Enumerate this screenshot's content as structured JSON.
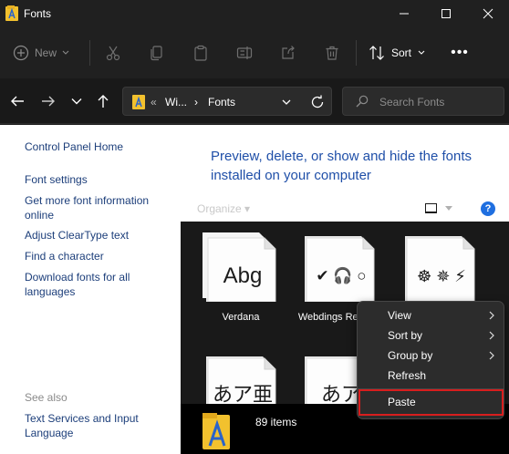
{
  "window": {
    "title": "Fonts"
  },
  "command_bar": {
    "new_label": "New",
    "sort_label": "Sort",
    "more_label": "•••",
    "icons": [
      "cut-icon",
      "copy-icon",
      "paste-icon",
      "rename-icon",
      "share-icon",
      "delete-icon"
    ]
  },
  "address": {
    "overflow": "«",
    "crumb1": "Wi...",
    "separator": "›",
    "crumb2": "Fonts"
  },
  "search": {
    "placeholder": "Search Fonts"
  },
  "left_pane": {
    "home_link": "Control Panel Home",
    "links": [
      "Font settings",
      "Get more font information online",
      "Adjust ClearType text",
      "Find a character",
      "Download fonts for all languages"
    ],
    "see_also_label": "See also",
    "see_also_links": [
      "Text Services and Input Language"
    ]
  },
  "main": {
    "headline": "Preview, delete, or show and hide the fonts installed on your computer",
    "organize_label": "Organize ▾",
    "help_label": "?",
    "fonts": [
      {
        "sample": "Abg",
        "name": "Verdana"
      },
      {
        "sample": "✔ 🎧 ○",
        "name": "Webdings Regular"
      },
      {
        "sample": "☸ ✵ ⚡",
        "name": ""
      },
      {
        "sample": "あア亜",
        "name": ""
      },
      {
        "sample": "あア",
        "name": ""
      }
    ]
  },
  "status": {
    "item_count": "89 items"
  },
  "context_menu": {
    "items": [
      {
        "label": "View",
        "submenu": true
      },
      {
        "label": "Sort by",
        "submenu": true
      },
      {
        "label": "Group by",
        "submenu": true
      },
      {
        "label": "Refresh",
        "submenu": false
      }
    ],
    "paste_label": "Paste",
    "highlight_color": "#d81e1e"
  },
  "colors": {
    "accent_link": "#1c3e7a",
    "headline": "#1f4fa8",
    "dark_bg": "#202020",
    "folder_yellow": "#f2c12e"
  }
}
